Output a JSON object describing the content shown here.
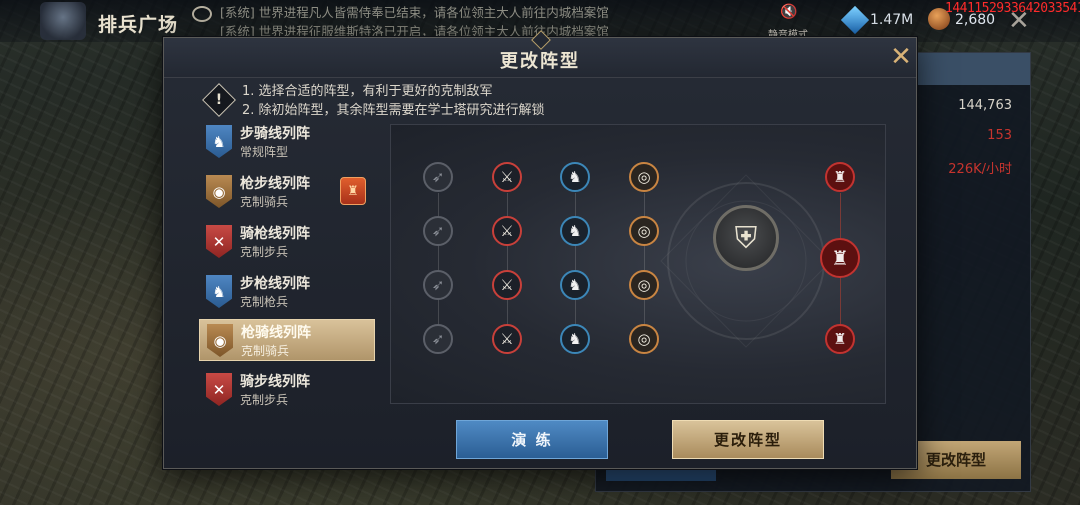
{
  "background": {
    "scene_title": "排兵广场",
    "news": [
      "[系统] 世界进程凡人皆需侍奉已结束，请各位领主大人前往内城档案馆",
      "[系统] 世界进程征服维斯特洛已开启，请各位领主大人前往内城档案馆"
    ],
    "mute_label": "静音模式",
    "gems": "1.47M",
    "coins": "2,680",
    "debug_id": "1441152933642033541",
    "stats": [
      "144,763",
      "153",
      "226K/小时"
    ],
    "change_button": "更改阵型"
  },
  "modal": {
    "title": "更改阵型",
    "tips": [
      "1. 选择合适的阵型，有利于更好的克制敌军",
      "2. 除初始阵型，其余阵型需要在学士塔研究进行解锁"
    ],
    "formations": [
      {
        "name": "步骑线列阵",
        "sub": "常规阵型",
        "badge": "blue",
        "icon": "horse-icon"
      },
      {
        "name": "枪步线列阵",
        "sub": "克制骑兵",
        "badge": "bronze",
        "icon": "spear-icon"
      },
      {
        "name": "骑枪线列阵",
        "sub": "克制步兵",
        "badge": "red",
        "icon": "swords-icon"
      },
      {
        "name": "步枪线列阵",
        "sub": "克制枪兵",
        "badge": "blue",
        "icon": "horse-icon"
      },
      {
        "name": "枪骑线列阵",
        "sub": "克制骑兵",
        "badge": "bronze",
        "icon": "spear-icon"
      },
      {
        "name": "骑步线列阵",
        "sub": "克制步兵",
        "badge": "red",
        "icon": "swords-icon"
      }
    ],
    "selected_index": 4,
    "grid_columns": [
      "bow",
      "sword",
      "horse",
      "spear"
    ],
    "drill_button": "演 练",
    "change_button": "更改阵型",
    "colors": {
      "accent_gold": "#d9c39a",
      "accent_blue": "#2b5e94",
      "enemy_red": "#c23330"
    }
  }
}
